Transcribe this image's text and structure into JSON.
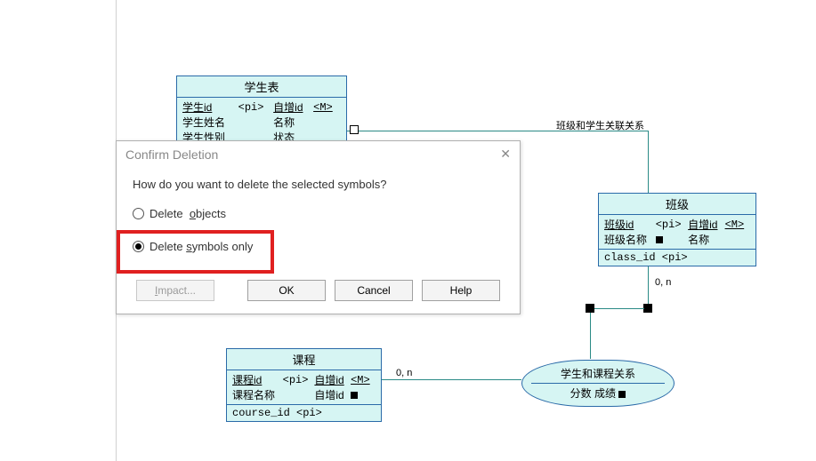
{
  "dialog": {
    "title": "Confirm Deletion",
    "message": "How do you want to delete the selected symbols?",
    "option_objects": "Delete  objects",
    "option_symbols": "Delete symbols only",
    "btn_impact": "Impact...",
    "btn_ok": "OK",
    "btn_cancel": "Cancel",
    "btn_help": "Help"
  },
  "entities": {
    "student": {
      "title": "学生表",
      "rows": [
        {
          "c1": "学生id",
          "c2": "<pi>",
          "c3": "自增id",
          "c4": "<M>",
          "u1": true,
          "u3": true,
          "u4": true
        },
        {
          "c1": "学生姓名",
          "c2": "",
          "c3": "名称",
          "c4": ""
        },
        {
          "c1": "学生性别",
          "c2": "",
          "c3": "状态",
          "c4": ""
        }
      ]
    },
    "class": {
      "title": "班级",
      "rows": [
        {
          "c1": "班级id",
          "c2": "<pi>",
          "c3": "自增id",
          "c4": "<M>",
          "u1": true,
          "u3": true,
          "u4": true
        },
        {
          "c1": "班级名称",
          "c2": "",
          "c3": "名称",
          "c4": "",
          "box": true
        }
      ],
      "pk": "class_id  <pi>"
    },
    "course": {
      "title": "课程",
      "rows": [
        {
          "c1": "课程id",
          "c2": "<pi>",
          "c3": "自增id",
          "c4": "<M>",
          "u1": true,
          "u3": true,
          "u4": true
        },
        {
          "c1": "课程名称",
          "c2": "",
          "c3": "自增id",
          "c4": "",
          "box": true
        }
      ],
      "pk": "course_id  <pi>"
    }
  },
  "relations": {
    "student_course": {
      "title": "学生和课程关系",
      "attrs": "分数   成绩"
    }
  },
  "labels": {
    "class_rel": "班级和学生关联关系",
    "card1": "0, n",
    "card2": "0, n"
  }
}
